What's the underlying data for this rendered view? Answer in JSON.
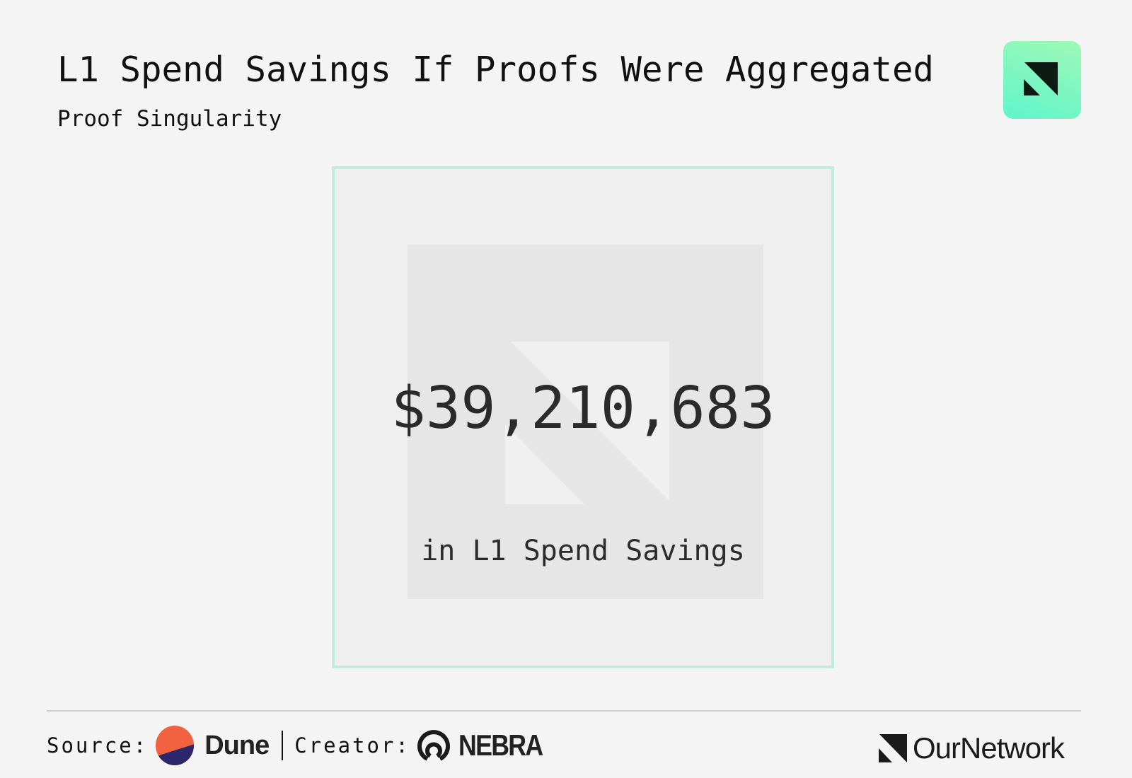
{
  "header": {
    "title": "L1 Spend Savings If Proofs Were Aggregated",
    "subtitle": "Proof Singularity",
    "logo_icon": "ournetwork-logo-icon"
  },
  "metric": {
    "value": "$39,210,683",
    "caption": "in L1 Spend Savings"
  },
  "footer": {
    "source_label": "Source:",
    "source_name": "Dune",
    "creator_label": "Creator:",
    "creator_name": "NEBRA",
    "publisher": "OurNetwork"
  },
  "colors": {
    "accent": "#5ff5cc",
    "frame_border": "#c3ece0",
    "dune_orange": "#f26241",
    "dune_navy": "#2b276b"
  }
}
